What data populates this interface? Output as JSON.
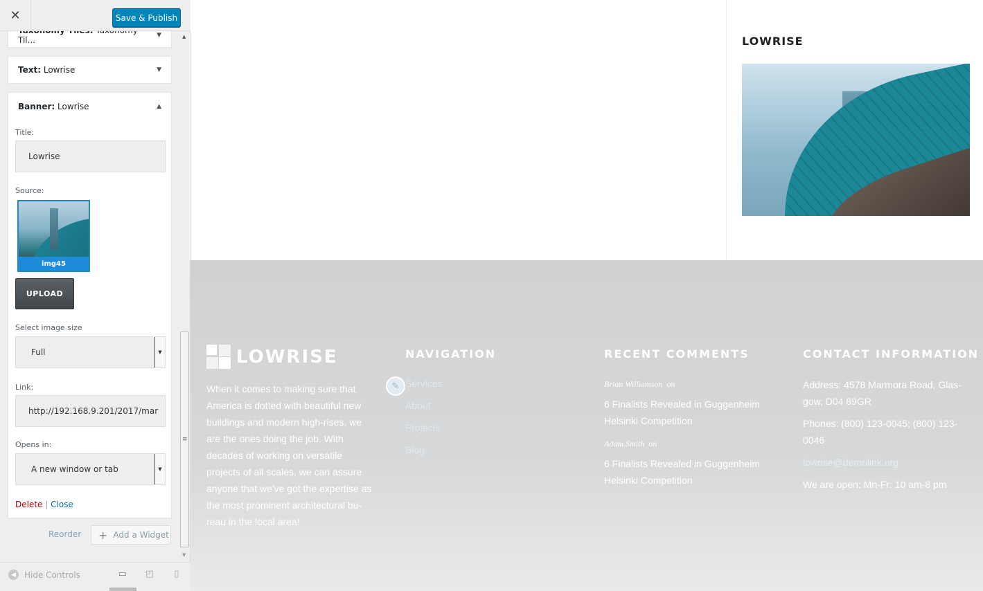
{
  "topbar": {
    "close_glyph": "✕",
    "publish_label": "Save & Publish"
  },
  "widgets": {
    "taxonomy": {
      "type": "Taxonomy Tiles:",
      "name": "Taxonomy Til..."
    },
    "text": {
      "type": "Text:",
      "name": "Lowrise"
    },
    "banner": {
      "type": "Banner:",
      "name": "Lowrise"
    }
  },
  "banner_form": {
    "title_label": "Title:",
    "title_value": "Lowrise",
    "source_label": "Source:",
    "image_caption": "img45",
    "upload_label": "UPLOAD",
    "size_label": "Select image size",
    "size_value": "Full",
    "link_label": "Link:",
    "link_value": "http://192.168.9.201/2017/mar",
    "opens_label": "Opens in:",
    "opens_value": "A new window or tab",
    "delete_label": "Delete",
    "separator": "|",
    "close_label": "Close"
  },
  "actions": {
    "reorder_label": "Reorder",
    "add_widget_label": "Add a Widget"
  },
  "bottom": {
    "hide_controls_label": "Hide Controls"
  },
  "preview": {
    "widget_title": "LOWRISE",
    "footer": {
      "logo_text": "LOWRISE",
      "about": "When it comes to making sure that America is dotted with beautiful new buildings and modern high-rises, we are the ones doing the job. With decades of working on versatile projects of all scales, we can assure anyone that we've got the expertise as the most prominent architectural bu-reau in the local area!",
      "navigation_title": "NAVIGATION",
      "nav_items": [
        "Services",
        "About",
        "Projects",
        "Blog"
      ],
      "comments_title": "RECENT COMMENTS",
      "comments": [
        {
          "author": "Brian Williamson",
          "on": "on",
          "text": "6 Finalists Revealed in Guggenheim Helsinki Competition"
        },
        {
          "author": "Adam Smith",
          "on": "on",
          "text": "6 Finalists Revealed in Guggenheim Helsinki Competition"
        }
      ],
      "contact_title": "CONTACT INFORMATION",
      "address": "Address: 4578 Marmora Road, Glas-gow, D04 89GR",
      "phones": "Phones: (800) 123-0045; (800) 123-0046",
      "email": "lowrise@demolink.org",
      "hours": "We are open: Mn-Fr: 10 am-8 pm"
    }
  },
  "colors": {
    "publish": "#0085ba",
    "link": "#0073aa",
    "delete": "#a00000",
    "footer_bg": "#d2d4d5"
  },
  "icons": [
    "close-icon",
    "chevron-down-icon",
    "chevron-up-icon",
    "plus-icon",
    "desktop-icon",
    "tablet-icon",
    "mobile-icon",
    "pencil-icon",
    "collapse-icon"
  ]
}
